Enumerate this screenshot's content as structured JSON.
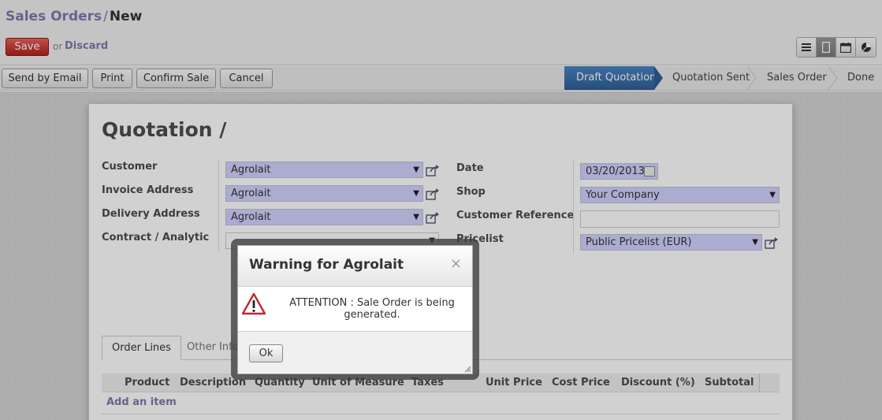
{
  "breadcrumb": {
    "parent": "Sales Orders",
    "separator": "/",
    "current": "New"
  },
  "actions": {
    "save": "Save",
    "or": "or",
    "discard": "Discard"
  },
  "views": [
    {
      "name": "list-view",
      "icon": "list-icon"
    },
    {
      "name": "form-view",
      "icon": "form-icon"
    },
    {
      "name": "calendar-view",
      "icon": "calendar-icon"
    },
    {
      "name": "graph-view",
      "icon": "pie-chart-icon"
    }
  ],
  "statusbar": {
    "buttons": [
      "Send by Email",
      "Print",
      "Confirm Sale",
      "Cancel"
    ],
    "stages": [
      "Draft Quotation",
      "Quotation Sent",
      "Sales Order",
      "Done"
    ],
    "active_stage": "Draft Quotation",
    "active_color": "#3b6fa8"
  },
  "form": {
    "title": "Quotation /",
    "left": {
      "customer_label": "Customer",
      "customer_value": "Agrolait",
      "invoice_label": "Invoice Address",
      "invoice_value": "Agrolait",
      "delivery_label": "Delivery Address",
      "delivery_value": "Agrolait",
      "contract_label": "Contract / Analytic",
      "contract_value": ""
    },
    "right": {
      "date_label": "Date",
      "date_value": "03/20/2013",
      "shop_label": "Shop",
      "shop_value": "Your Company",
      "customer_ref_label": "Customer Reference",
      "customer_ref_value": "",
      "pricelist_label": "Pricelist",
      "pricelist_value": "Public Pricelist (EUR)"
    },
    "required_color": "#d2d2ff"
  },
  "tabs": {
    "order_lines": "Order Lines",
    "other_info": "Other Infor"
  },
  "order_lines": {
    "columns": [
      "Product",
      "Description",
      "Quantity",
      "Unit of Measure",
      "Taxes",
      "Unit Price",
      "Cost Price",
      "Discount (%)",
      "Subtotal"
    ],
    "add_item": "Add an item"
  },
  "dialog": {
    "title": "Warning for Agrolait",
    "close": "×",
    "message": "ATTENTION : Sale Order is being generated.",
    "ok": "Ok"
  }
}
